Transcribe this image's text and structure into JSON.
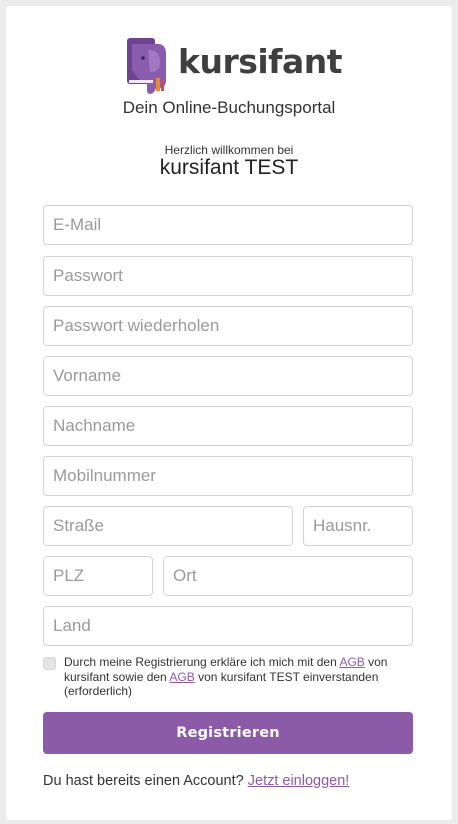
{
  "brand": {
    "logo_text": "kursifant",
    "tagline": "Dein Online-Buchungsportal",
    "welcome": "Herzlich willkommen bei",
    "portal_name": "kursifant TEST",
    "logo_icon": "elephant-book-icon",
    "colors": {
      "primary": "#8c5ba7",
      "logo_purple": "#7b4f9a",
      "logo_orange": "#e8893a",
      "logo_red": "#d94848"
    }
  },
  "form": {
    "email_placeholder": "E-Mail",
    "password_placeholder": "Passwort",
    "password_repeat_placeholder": "Passwort wiederholen",
    "firstname_placeholder": "Vorname",
    "lastname_placeholder": "Nachname",
    "mobile_placeholder": "Mobilnummer",
    "street_placeholder": "Straße",
    "housenumber_placeholder": "Hausnr.",
    "zip_placeholder": "PLZ",
    "city_placeholder": "Ort",
    "country_placeholder": "Land"
  },
  "consent": {
    "text_1": "Durch meine Registrierung erkläre ich mich mit den ",
    "agb_link_1": "AGB",
    "text_2": " von kursifant sowie den ",
    "agb_link_2": "AGB",
    "text_3": " von kursifant TEST einverstanden (erforderlich)",
    "checked": false
  },
  "actions": {
    "register_label": "Registrieren",
    "login_prompt": "Du hast bereits einen Account? ",
    "login_link": "Jetzt einloggen!"
  }
}
